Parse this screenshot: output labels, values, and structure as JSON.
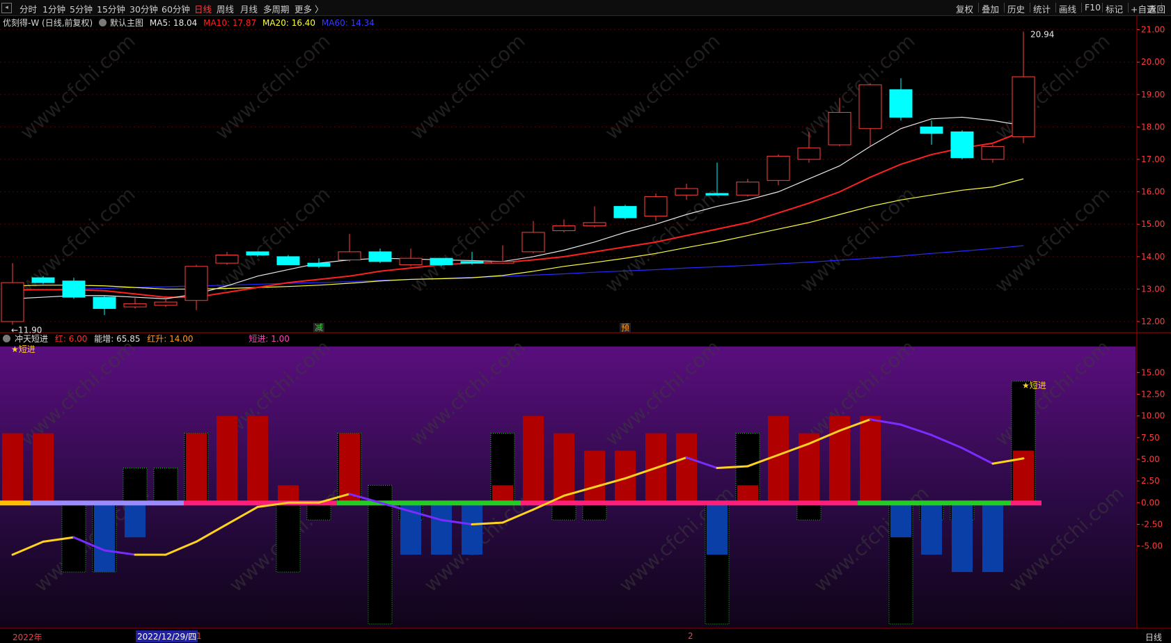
{
  "toolbar": {
    "collapse_icon": "◂",
    "periods": [
      "分时",
      "1分钟",
      "5分钟",
      "15分钟",
      "30分钟",
      "60分钟",
      "日线",
      "周线",
      "月线",
      "多周期",
      "更多 〉"
    ],
    "active_period": "日线",
    "right_buttons": [
      "复权",
      "叠加",
      "历史",
      "统计",
      "画线",
      "F10",
      "标记",
      "+自选",
      "返回"
    ]
  },
  "main_info": {
    "symbol": "优刻得-W (日线,前复权)",
    "template": "默认主图",
    "ma5": "MA5: 18.04",
    "ma10": "MA10: 17.87",
    "ma20": "MA20: 16.40",
    "ma60": "MA60: 14.34"
  },
  "indicator_info": {
    "name": "冲天短进",
    "hong": "红: 6.00",
    "nengzeng": "能增: 65.85",
    "hongsheng": "红升: 14.00",
    "duanjin": "短进: 1.00"
  },
  "colors": {
    "up": "#ff4040",
    "down": "#00ffff",
    "ma5": "#e8e8e8",
    "ma10": "#ff2020",
    "ma20": "#ffff3c",
    "ma60": "#2a2aff",
    "grid": "#5a0000",
    "axis": "#ff3b3b"
  },
  "chart_data": [
    {
      "type": "candlestick",
      "title": "优刻得-W (日线,前复权)",
      "ylim": [
        11.7,
        21.4
      ],
      "yticks": [
        "21.00",
        "20.00",
        "19.00",
        "18.00",
        "17.00",
        "16.00",
        "15.00",
        "14.00",
        "13.00",
        "12.00"
      ],
      "candles": [
        {
          "o": 12.0,
          "c": 13.2,
          "h": 13.8,
          "l": 11.9
        },
        {
          "o": 13.35,
          "c": 13.2,
          "h": 13.4,
          "l": 13.15
        },
        {
          "o": 13.25,
          "c": 12.75,
          "h": 13.35,
          "l": 12.7
        },
        {
          "o": 12.75,
          "c": 12.4,
          "h": 12.8,
          "l": 12.2
        },
        {
          "o": 12.45,
          "c": 12.55,
          "h": 12.75,
          "l": 12.4
        },
        {
          "o": 12.5,
          "c": 12.6,
          "h": 12.75,
          "l": 12.45
        },
        {
          "o": 12.65,
          "c": 13.7,
          "h": 13.75,
          "l": 12.35
        },
        {
          "o": 13.8,
          "c": 14.05,
          "h": 14.15,
          "l": 13.75
        },
        {
          "o": 14.15,
          "c": 14.05,
          "h": 14.15,
          "l": 14.0
        },
        {
          "o": 14.0,
          "c": 13.75,
          "h": 14.05,
          "l": 13.75
        },
        {
          "o": 13.8,
          "c": 13.7,
          "h": 13.95,
          "l": 13.65
        },
        {
          "o": 13.9,
          "c": 14.15,
          "h": 14.7,
          "l": 13.85
        },
        {
          "o": 14.15,
          "c": 13.85,
          "h": 14.25,
          "l": 13.8
        },
        {
          "o": 13.75,
          "c": 13.95,
          "h": 14.25,
          "l": 13.7
        },
        {
          "o": 13.95,
          "c": 13.75,
          "h": 13.95,
          "l": 13.7
        },
        {
          "o": 13.85,
          "c": 13.8,
          "h": 14.15,
          "l": 13.75
        },
        {
          "o": 13.8,
          "c": 13.85,
          "h": 14.35,
          "l": 13.78
        },
        {
          "o": 14.15,
          "c": 14.75,
          "h": 15.1,
          "l": 14.1
        },
        {
          "o": 14.8,
          "c": 14.95,
          "h": 15.15,
          "l": 14.75
        },
        {
          "o": 14.95,
          "c": 15.05,
          "h": 15.55,
          "l": 14.9
        },
        {
          "o": 15.55,
          "c": 15.2,
          "h": 15.6,
          "l": 15.15
        },
        {
          "o": 15.25,
          "c": 15.85,
          "h": 15.95,
          "l": 15.1
        },
        {
          "o": 15.9,
          "c": 16.1,
          "h": 16.25,
          "l": 15.75
        },
        {
          "o": 15.95,
          "c": 15.9,
          "h": 16.9,
          "l": 15.9
        },
        {
          "o": 15.9,
          "c": 16.3,
          "h": 16.4,
          "l": 15.85
        },
        {
          "o": 16.35,
          "c": 17.1,
          "h": 17.15,
          "l": 16.2
        },
        {
          "o": 17.0,
          "c": 17.35,
          "h": 17.85,
          "l": 16.9
        },
        {
          "o": 17.45,
          "c": 18.45,
          "h": 18.9,
          "l": 17.4
        },
        {
          "o": 17.95,
          "c": 19.3,
          "h": 19.35,
          "l": 17.4
        },
        {
          "o": 19.15,
          "c": 18.3,
          "h": 19.5,
          "l": 18.2
        },
        {
          "o": 18.0,
          "c": 17.8,
          "h": 18.2,
          "l": 17.45
        },
        {
          "o": 17.85,
          "c": 17.05,
          "h": 17.9,
          "l": 17.0
        },
        {
          "o": 17.0,
          "c": 17.4,
          "h": 17.45,
          "l": 16.9
        },
        {
          "o": 17.7,
          "c": 19.55,
          "h": 20.94,
          "l": 17.5
        }
      ],
      "ma5": [
        12.7,
        12.75,
        12.8,
        12.8,
        12.75,
        12.7,
        12.85,
        13.1,
        13.4,
        13.6,
        13.8,
        13.9,
        13.95,
        13.93,
        13.9,
        13.88,
        13.85,
        14.0,
        14.2,
        14.45,
        14.75,
        15.0,
        15.3,
        15.55,
        15.75,
        16.0,
        16.4,
        16.8,
        17.4,
        17.95,
        18.25,
        18.3,
        18.2,
        18.04
      ],
      "ma10": [
        12.98,
        12.98,
        12.98,
        12.95,
        12.85,
        12.75,
        12.75,
        12.9,
        13.05,
        13.2,
        13.3,
        13.4,
        13.55,
        13.65,
        13.75,
        13.8,
        13.82,
        13.9,
        14.0,
        14.15,
        14.3,
        14.45,
        14.65,
        14.85,
        15.05,
        15.35,
        15.65,
        16.0,
        16.45,
        16.85,
        17.15,
        17.35,
        17.5,
        17.87
      ],
      "ma20": [
        13.1,
        13.12,
        13.12,
        13.1,
        13.05,
        13.0,
        13.0,
        13.02,
        13.05,
        13.08,
        13.12,
        13.18,
        13.25,
        13.3,
        13.32,
        13.35,
        13.42,
        13.55,
        13.7,
        13.82,
        13.95,
        14.1,
        14.28,
        14.45,
        14.65,
        14.85,
        15.05,
        15.3,
        15.55,
        15.75,
        15.9,
        16.05,
        16.15,
        16.4
      ],
      "ma60": [
        12.95,
        12.98,
        13.0,
        13.02,
        13.05,
        13.07,
        13.1,
        13.12,
        13.15,
        13.18,
        13.2,
        13.23,
        13.27,
        13.3,
        13.33,
        13.36,
        13.39,
        13.43,
        13.47,
        13.52,
        13.56,
        13.6,
        13.65,
        13.69,
        13.73,
        13.78,
        13.83,
        13.89,
        13.95,
        14.02,
        14.1,
        14.17,
        14.25,
        14.34
      ],
      "annotations": [
        {
          "text": "←11.90",
          "index": 0,
          "value": 11.9
        },
        {
          "text": "20.94",
          "index": 33,
          "value": 20.94
        },
        {
          "text": "减",
          "index": 10,
          "value": null
        },
        {
          "text": "预",
          "index": 20,
          "value": null
        }
      ]
    },
    {
      "type": "bar",
      "title": "冲天短进",
      "ylim": [
        -14.5,
        18.0
      ],
      "yticks": [
        "15.00",
        "12.50",
        "10.00",
        "7.50",
        "5.00",
        "2.50",
        "0.00",
        "-2.50",
        "-5.00"
      ],
      "pos_red": [
        8,
        8,
        0,
        0,
        0,
        0,
        8,
        10,
        10,
        2,
        0,
        8,
        0,
        0,
        0,
        0,
        2,
        10,
        8,
        6,
        6,
        8,
        8,
        0,
        2,
        10,
        8,
        10,
        10,
        0,
        0,
        0,
        0,
        6
      ],
      "pos_black": [
        0,
        0,
        0,
        0,
        4,
        4,
        8,
        0,
        0,
        0,
        0,
        8,
        2,
        0,
        0,
        0,
        8,
        0,
        0,
        0,
        0,
        0,
        0,
        0,
        8,
        0,
        0,
        0,
        0,
        0,
        0,
        0,
        0,
        14
      ],
      "neg_blue": [
        0,
        0,
        0,
        -8,
        -4,
        0,
        0,
        0,
        0,
        0,
        0,
        0,
        0,
        -6,
        -6,
        -6,
        0,
        0,
        0,
        0,
        0,
        0,
        0,
        -6,
        0,
        0,
        0,
        0,
        0,
        -4,
        -6,
        -8,
        -8,
        0
      ],
      "neg_black": [
        0,
        0,
        -8,
        -8,
        0,
        0,
        0,
        0,
        0,
        -8,
        -2,
        0,
        -14,
        -2,
        0,
        0,
        0,
        0,
        -2,
        -2,
        0,
        0,
        0,
        -14,
        0,
        0,
        -2,
        0,
        0,
        -14,
        -2,
        -2,
        0,
        0
      ],
      "line": [
        -6,
        -4.5,
        -4,
        -5.5,
        -6,
        -6,
        -4.5,
        -2.5,
        -0.5,
        0,
        0,
        1,
        0,
        -1,
        -2,
        -2.5,
        -2.3,
        -0.8,
        0.8,
        1.8,
        2.8,
        4,
        5.2,
        4,
        4.2,
        5.5,
        6.8,
        8.3,
        9.6,
        9,
        7.8,
        6.3,
        4.5,
        5.1
      ],
      "baseline_segments": [
        {
          "from": 0,
          "to": 0,
          "color": "#ffc000"
        },
        {
          "from": 1,
          "to": 5,
          "color": "#9a8cff"
        },
        {
          "from": 6,
          "to": 10,
          "color": "#ff1f7a"
        },
        {
          "from": 11,
          "to": 16,
          "color": "#22cc22"
        },
        {
          "from": 17,
          "to": 27,
          "color": "#ff1f7a"
        },
        {
          "from": 28,
          "to": 32,
          "color": "#22cc22"
        },
        {
          "from": 33,
          "to": 33,
          "color": "#ff1f7a"
        }
      ],
      "signals": [
        {
          "text": "★短进",
          "index": 0
        },
        {
          "text": "★短进",
          "index": 33
        }
      ]
    }
  ],
  "bottom": {
    "year": "2022年",
    "date": "2022/12/29/四",
    "mark1": "1",
    "mark2": "2",
    "period": "日线"
  },
  "watermark": "www.cfchi.com"
}
